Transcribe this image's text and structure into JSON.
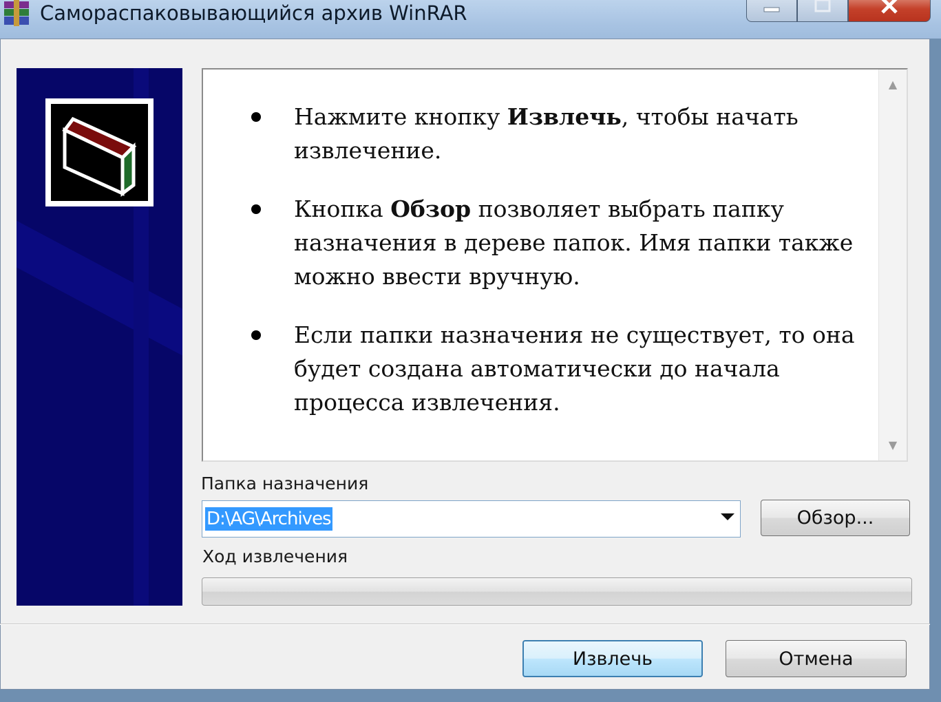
{
  "window": {
    "title": "Самораспаковывающийся архив WinRAR"
  },
  "info": {
    "items": [
      {
        "pre": "Нажмите кнопку ",
        "bold": "Извлечь",
        "post": ", чтобы начать извлечение."
      },
      {
        "pre": "Кнопка ",
        "bold": "Обзор",
        "post": " позволяет выбрать папку назначения в дереве папок. Имя папки также можно ввести вручную."
      },
      {
        "pre": "",
        "bold": "",
        "post": "Если папки назначения не существует, то она будет создана автоматически до начала процесса извлечения."
      }
    ]
  },
  "destination": {
    "label": "Папка назначения",
    "value": "D:\\AG\\Archives",
    "browse_label": "Обзор..."
  },
  "progress": {
    "label": "Ход извлечения",
    "fraction": 0
  },
  "buttons": {
    "extract_label": "Извлечь",
    "cancel_label": "Отмена"
  },
  "icons": {
    "app": "winrar-books-icon",
    "logo": "archive-box-icon",
    "minimize": "minimize-icon",
    "maximize": "maximize-icon",
    "close": "close-icon"
  },
  "colors": {
    "side_panel": "#060668",
    "selection": "#3399ff",
    "close_button": "#c4412a"
  }
}
